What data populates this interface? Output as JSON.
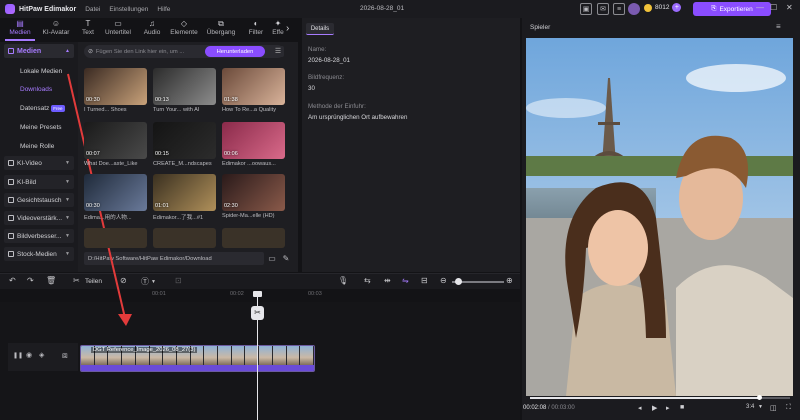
{
  "app": {
    "name": "HitPaw Edimakor",
    "document_title": "2026-08-28_01"
  },
  "menu": [
    "Datei",
    "Einstellungen",
    "Hilfe"
  ],
  "credits": {
    "value": "8012"
  },
  "export_label": "Exportieren",
  "tabs": [
    {
      "label": "Medien",
      "icon": "media-icon"
    },
    {
      "label": "KI-Avatar",
      "icon": "avatar-icon"
    },
    {
      "label": "Text",
      "icon": "text-icon"
    },
    {
      "label": "Untertitel",
      "icon": "subtitle-icon"
    },
    {
      "label": "Audio",
      "icon": "audio-icon"
    },
    {
      "label": "Elemente",
      "icon": "elements-icon"
    },
    {
      "label": "Übergang",
      "icon": "transition-icon"
    },
    {
      "label": "Filter",
      "icon": "filter-icon"
    },
    {
      "label": "Effe",
      "icon": "effects-icon"
    }
  ],
  "sidebar": {
    "header": "Medien",
    "items": [
      {
        "label": "Lokale Medien"
      },
      {
        "label": "Downloads"
      },
      {
        "label": "Datensatz",
        "badge": "Free"
      },
      {
        "label": "Meine Presets"
      },
      {
        "label": "Meine Rolle"
      }
    ],
    "groups": [
      "KI-Video",
      "KI-Bild",
      "Gesichtstausch",
      "Videoverstärk...",
      "Bildverbesser...",
      "Stock-Medien"
    ]
  },
  "media": {
    "link_placeholder": "Fügen Sie den Link hier ein, um ...",
    "download_button": "Herunterladen",
    "thumbnails": [
      {
        "duration": "00:30",
        "caption": "I Turned... Shoes",
        "colors": [
          "#3a2a22",
          "#c9a27a"
        ]
      },
      {
        "duration": "00:13",
        "caption": "Turn Your... with AI",
        "colors": [
          "#2b2b2b",
          "#8c8c8c"
        ]
      },
      {
        "duration": "01:38",
        "caption": "How To Re...a Quality",
        "colors": [
          "#6b4a3a",
          "#d9b39a"
        ]
      },
      {
        "duration": "00:07",
        "caption": "What Doe...aste_Like",
        "colors": [
          "#1a1a1a",
          "#4a4a4a"
        ]
      },
      {
        "duration": "00:15",
        "caption": "CREATE_M...ndscapes",
        "colors": [
          "#141414",
          "#2c2c2c"
        ]
      },
      {
        "duration": "00:06",
        "caption": "Edimakor ...oowaus...",
        "colors": [
          "#8a2a4a",
          "#d96a8a"
        ]
      },
      {
        "duration": "00:30",
        "caption": "Edima...用的人物...",
        "colors": [
          "#1f2a3a",
          "#6a7a9a"
        ]
      },
      {
        "duration": "01:01",
        "caption": "Edimakor...了我...#1",
        "colors": [
          "#3a3020",
          "#b0905a"
        ]
      },
      {
        "duration": "02:30",
        "caption": "Spider-Ma...elle (HD)",
        "colors": [
          "#2a1a1a",
          "#8a5a4a"
        ]
      }
    ],
    "path": "D:/HitPaw Software/HitPaw Edimakor/Download"
  },
  "details": {
    "tab": "Details",
    "fields": [
      {
        "label": "Name:",
        "value": "2026-08-28_01"
      },
      {
        "label": "Bildfrequenz:",
        "value": "30"
      },
      {
        "label": "Methode der Einfuhr:",
        "value": "Am ursprünglichen Ort aufbewahren"
      }
    ]
  },
  "player": {
    "title": "Spieler",
    "current_time": "00:02:08",
    "total_time": "/ 00:03:00",
    "aspect": "3:4",
    "progress": 0.88
  },
  "timeline": {
    "split_label": "Teilen",
    "ticks": [
      "00:01",
      "00:02",
      "00:03"
    ],
    "clip_label": "DGT Reference_Image_2026_08_27(3)"
  }
}
